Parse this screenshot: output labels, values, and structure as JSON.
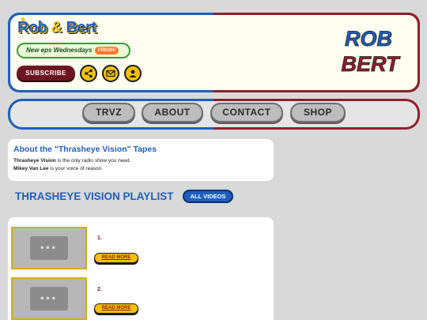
{
  "brand": {
    "logo_text_a": "Rob",
    "logo_amp": "&",
    "logo_text_b": "Bert",
    "big_logo_line1": "ROB",
    "big_logo_line2": "BERT"
  },
  "header": {
    "new_eps": "New eps Wednesdays",
    "fresh": "FRESH!",
    "subscribe": "SUBSCRIBE",
    "icons": [
      "share-icon",
      "email-icon",
      "user-icon"
    ]
  },
  "nav": {
    "items": [
      "TRVZ",
      "ABOUT",
      "CONTACT",
      "SHOP"
    ]
  },
  "about": {
    "heading": "About the \"Thrasheye Vision\" Tapes",
    "line1_bold": "Thrasheye Vision",
    "line1_rest": " is the only radio show you need.",
    "line2_bold": "Mikey Van Lee",
    "line2_rest": " is your voice of reason."
  },
  "playlist": {
    "title": "THRASHEYE VISION PLAYLIST",
    "all_videos": "ALL VIDEOS",
    "items": [
      {
        "num": "1.",
        "cta": "READ MORE"
      },
      {
        "num": "2.",
        "cta": "READ MORE"
      }
    ]
  },
  "colors": {
    "blue": "#1d5fbf",
    "maroon": "#8f1f2a",
    "yellow": "#f2c200",
    "cream": "#fffef1"
  }
}
